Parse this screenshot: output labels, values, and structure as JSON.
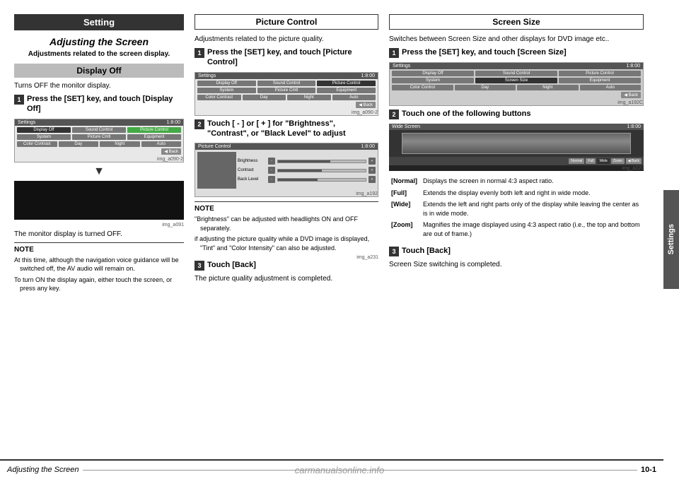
{
  "page": {
    "title": "Adjusting the Screen",
    "page_number": "10-1",
    "watermark": "carmanualsonline.info",
    "side_tab": "Settings"
  },
  "footer": {
    "title": "Adjusting the Screen",
    "page": "10-1"
  },
  "left_col": {
    "section_header": "Setting",
    "italic_title": "Adjusting the Screen",
    "subtitle": "Adjustments related to the screen display.",
    "subsection": "Display Off",
    "subsection_desc": "Turns OFF the monitor display.",
    "step1_num": "1",
    "step1_text": "Press the [SET] key, and touch [Display Off]",
    "screen1_title": "Settings",
    "screen1_time": "1:8:00",
    "screen1_nav": [
      "Display Off",
      "Sound Control",
      "Picture Control"
    ],
    "screen1_nav2": [
      "System",
      "Picture Cmtl",
      "Equipment"
    ],
    "screen1_nav3": [
      "Color Contrast",
      "Day",
      "Night",
      "Auto"
    ],
    "screen1_back": "Back",
    "screen1_caption": "img_a090-2",
    "arrow_down": "▼",
    "dark_screen_caption": "img_a091",
    "monitor_off_text": "The monitor display is turned OFF.",
    "note_title": "NOTE",
    "note_items": [
      "At this time, although the navigation voice guidance will be switched off, the AV audio will remain on.",
      "To turn ON the display again, either touch the screen, or press any key."
    ]
  },
  "mid_col": {
    "section_header": "Picture Control",
    "section_desc": "Adjustments related to the picture quality.",
    "step1_num": "1",
    "step1_text": "Press the [SET] key, and touch [Picture Control]",
    "screen1_title": "Settings",
    "screen1_time": "1:8:00",
    "screen1_nav": [
      "Display Off",
      "Sound Control",
      "Picture Control"
    ],
    "screen1_nav2": [
      "System",
      "Picture Cmtl",
      "Equipment"
    ],
    "screen1_nav3": [
      "Color Contrast",
      "Day",
      "Night",
      "Auto"
    ],
    "screen1_back": "Back",
    "screen1_caption": "img_a090-2",
    "step2_num": "2",
    "step2_text": "Touch [ - ] or [ + ] for \"Brightness\", \"Contrast\", or \"Black Level\" to adjust",
    "screen2_title": "Picture Control",
    "screen2_time": "1:8:00",
    "screen2_caption": "img_a192",
    "note_title": "NOTE",
    "note_items": [
      "\"Brightness\" can be adjusted with headlights ON and OFF separately.",
      "if adjusting the picture quality while a DVD image is displayed, \"Tint\" and \"Color Intensity\" can also be adjusted."
    ],
    "screen3_caption": "img_a231",
    "step3_num": "3",
    "step3_text": "Touch [Back]",
    "step3_desc": "The picture quality adjustment is completed."
  },
  "right_col": {
    "section_header": "Screen Size",
    "section_desc": "Switches between Screen Size and other displays for DVD image etc..",
    "step1_num": "1",
    "step1_text": "Press the [SET] key, and touch [Screen Size]",
    "screen1_title": "Settings",
    "screen1_time": "1:8:00",
    "screen1_nav": [
      "Display Off",
      "Sound Control",
      "Picture Control"
    ],
    "screen1_nav2": [
      "System",
      "Screen Size",
      "Equipment"
    ],
    "screen1_nav3": [
      "Color Control",
      "Day",
      "Night",
      "Auto"
    ],
    "screen1_back": "Back",
    "screen1_caption": "img_a192C",
    "step2_num": "2",
    "step2_text": "Touch one of the following buttons",
    "wide_screen_title": "Wide Screen",
    "wide_screen_time": "1:8:00",
    "wide_screen_controls": [
      "Normal",
      "Full",
      "Wide",
      "Zoom",
      "Back"
    ],
    "wide_screen_caption": "img_a220",
    "options": [
      {
        "label": "[Normal]",
        "desc": "Displays the screen in normal 4:3 aspect ratio."
      },
      {
        "label": "[Full]",
        "desc": "Extends the display evenly both left and right in wide mode."
      },
      {
        "label": "[Wide]",
        "desc": "Extends the left and right parts only of the display while leaving the center as is in wide mode."
      },
      {
        "label": "[Zoom]",
        "desc": "Magnifies the image displayed using 4:3 aspect ratio (i.e., the top and bottom are out of frame.)"
      }
    ],
    "step3_num": "3",
    "step3_text": "Touch [Back]",
    "step3_desc": "Screen Size switching is completed."
  }
}
